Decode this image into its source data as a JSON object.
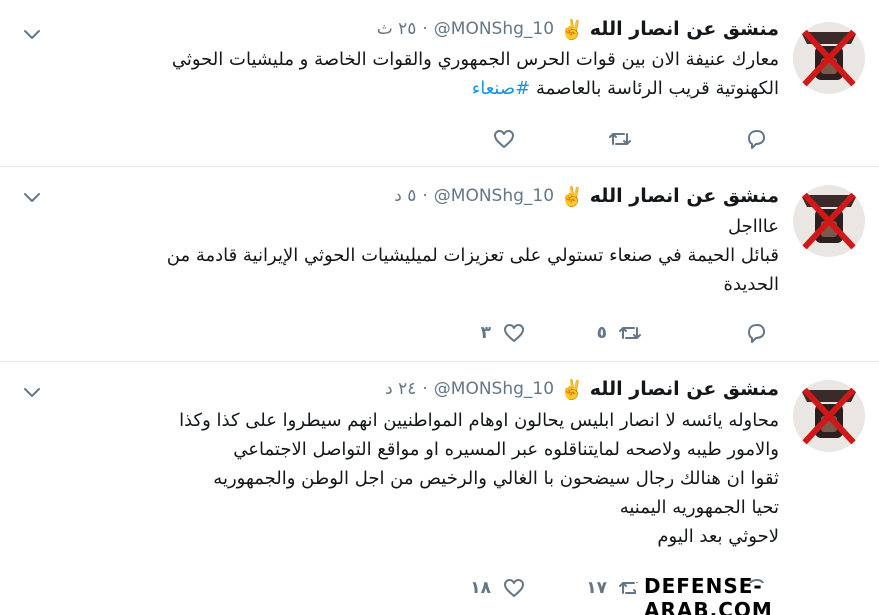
{
  "tweets": [
    {
      "name": "منشق عن انصار الله",
      "emoji": "✌️",
      "handle": "@MONShg_10",
      "dot": "·",
      "time": "٢٥ ث",
      "lines": [
        "معارك عنيفة الان بين قوات الحرس الجمهوري والقوات الخاصة و مليشيات الحوثي",
        "الكهنوتية قريب الرئاسة بالعاصمة"
      ],
      "hashtag": "#صنعاء",
      "counts": {
        "reply": "",
        "retweet": "",
        "like": ""
      }
    },
    {
      "name": "منشق عن انصار الله",
      "emoji": "✌️",
      "handle": "@MONShg_10",
      "dot": "·",
      "time": "٥ د",
      "lines": [
        "عاااجل",
        "قبائل الحيمة في صنعاء تستولي على تعزيزات لميليشيات الحوثي الإيرانية قادمة من",
        "الحديدة"
      ],
      "counts": {
        "reply": "",
        "retweet": "٥",
        "like": "٣"
      }
    },
    {
      "name": "منشق عن انصار الله",
      "emoji": "✌️",
      "handle": "@MONShg_10",
      "dot": "·",
      "time": "٢٤ د",
      "lines": [
        "محاوله يائسه لا انصار ابليس يحالون اوهام المواطنيين انهم سيطروا على كذا وكذا",
        "والامور طيبه ولاصحه لمايتناقلوه عبر المسيره او مواقع التواصل الاجتماعي",
        "ثقوا ان هنالك رجال سيضحون با الغالي والرخيص من اجل الوطن والجمهوريه",
        "تحيا الجمهوريه اليمنيه",
        "لاحوثي بعد اليوم"
      ],
      "counts": {
        "reply": "",
        "retweet": "١٧",
        "like": "١٨"
      }
    }
  ],
  "watermark": "DEFENSE-ARAB.COM",
  "colors": {
    "secondary": "#657786",
    "link": "#1b95e0",
    "divider": "#e1e8ed"
  }
}
